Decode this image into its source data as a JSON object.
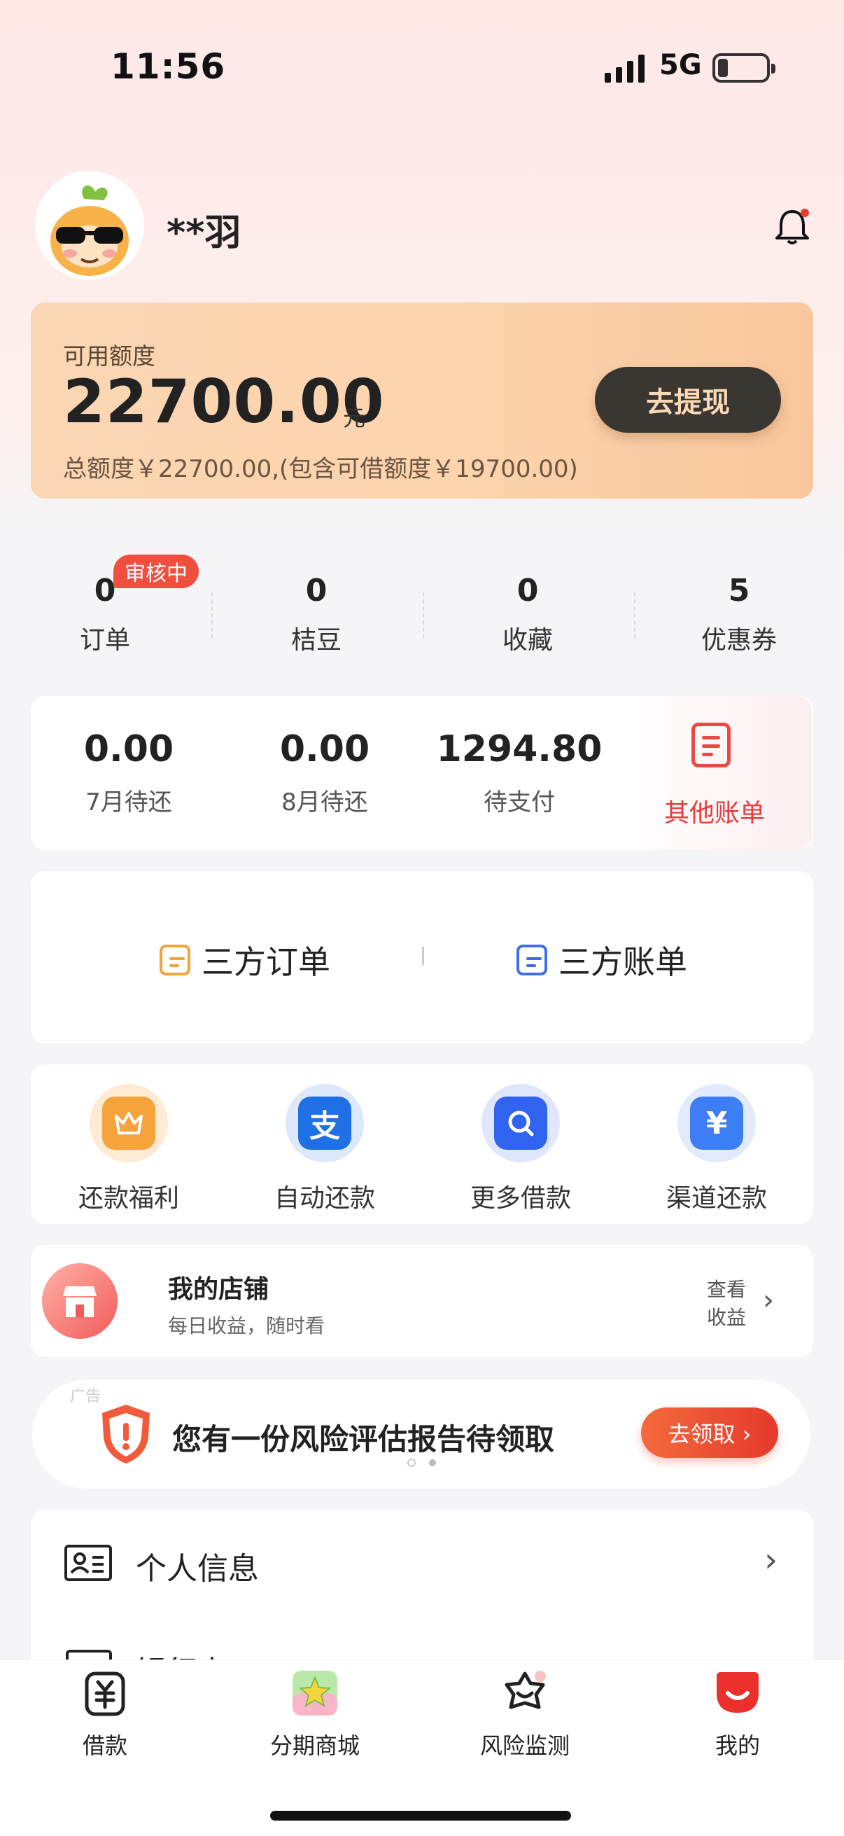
{
  "status_bar": {
    "time": "11:56",
    "network": "5G"
  },
  "profile": {
    "username": "**羽"
  },
  "credit": {
    "label": "可用额度",
    "amount": "22700.00",
    "unit": "元",
    "total_text": "总额度￥22700.00,(包含可借额度￥19700.00)",
    "withdraw_label": "去提现"
  },
  "stats": [
    {
      "value": "0",
      "label": "订单",
      "badge": "审核中"
    },
    {
      "value": "0",
      "label": "桔豆"
    },
    {
      "value": "0",
      "label": "收藏"
    },
    {
      "value": "5",
      "label": "优惠券"
    }
  ],
  "bills": [
    {
      "value": "0.00",
      "label": "7月待还"
    },
    {
      "value": "0.00",
      "label": "8月待还"
    },
    {
      "value": "1294.80",
      "label": "待支付"
    }
  ],
  "other_bill": {
    "label": "其他账单"
  },
  "third_party": {
    "orders_label": "三方订单",
    "bills_label": "三方账单"
  },
  "quick_actions": [
    {
      "label": "还款福利",
      "icon": "crown-icon",
      "color": "#f5a33a"
    },
    {
      "label": "自动还款",
      "icon": "alipay-icon",
      "glyph": "支",
      "color": "#1f6fe5"
    },
    {
      "label": "更多借款",
      "icon": "search-icon",
      "color": "#2f63f0"
    },
    {
      "label": "渠道还款",
      "icon": "yuan-icon",
      "glyph": "¥",
      "color": "#3d7ef5"
    }
  ],
  "shop": {
    "title": "我的店铺",
    "subtitle": "每日收益，随时看",
    "view_line1": "查看",
    "view_line2": "收益"
  },
  "risk_banner": {
    "ad_tag": "广告",
    "text": "您有一份风险评估报告待领取",
    "button": "去领取 ›"
  },
  "menu": [
    {
      "label": "个人信息"
    },
    {
      "label": "银行卡"
    }
  ],
  "tabbar": [
    {
      "label": "借款",
      "icon": "loan-icon"
    },
    {
      "label": "分期商城",
      "icon": "mall-icon"
    },
    {
      "label": "风险监测",
      "icon": "risk-monitor-icon"
    },
    {
      "label": "我的",
      "icon": "mine-icon",
      "active_color": "#e9302b"
    }
  ],
  "colors": {
    "accent_red": "#e93b3b",
    "credit_bg": "#fcd4ad",
    "dark_button": "#3a3632"
  }
}
